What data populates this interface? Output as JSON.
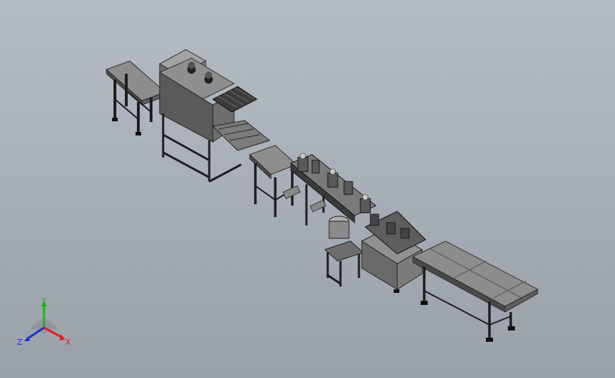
{
  "viewport": {
    "background_top": "#b6bcc6",
    "background_bottom": "#9aa0a8"
  },
  "model": {
    "description_icon": "production-line-assembly",
    "colors": {
      "metal_light": "#9a9a9a",
      "metal_mid": "#6f6f6f",
      "metal_dark": "#2c2c2c",
      "frame": "#1e1e1e"
    }
  },
  "triad": {
    "x_label": "X",
    "y_label": "Y",
    "z_label": "Z",
    "x_color": "#e02020",
    "y_color": "#20b020",
    "z_color": "#2030d0"
  }
}
